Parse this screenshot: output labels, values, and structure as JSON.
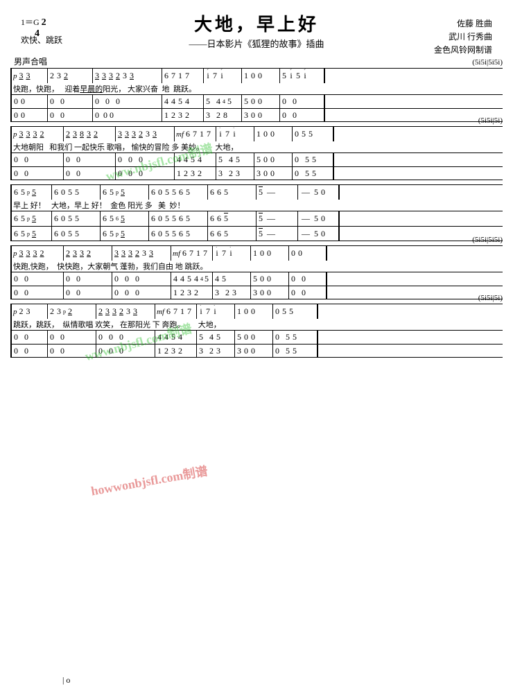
{
  "title": "大地，早上好",
  "subtitle": "——日本影片《狐狸的故事》插曲",
  "composer": {
    "line1": "佐藤 胜曲",
    "line2": "武川 行秀曲",
    "line3": "金色风铃网制谱"
  },
  "meta": {
    "key": "1＝G",
    "time": "2/4",
    "tempo": "欢快、跳跃"
  },
  "voice_label": "男声合唱",
  "watermark1": "www.nbjsfl.com制谱",
  "watermark2": "www.nbjsfl.com制谱",
  "hint1": "(5i5i|5i5i)",
  "hint2": "(5i5i|5i)",
  "hint3": "(5i5i|5i5i)",
  "hint4": "(5i5i|5i)",
  "systems": [
    {
      "id": "sys1",
      "hint": "(5i5i|5i5i)",
      "rows": [
        {
          "type": "notation",
          "dynamic": "p",
          "content": "3  3 | 2 3  2 | 3 3 3 2  3  3 | 6 7 1 7 | i  7 i | 1 0 0 | 5 i 5 i"
        },
        {
          "type": "lyrics",
          "content": "快跑，快跑，    迎着早晨的阳光，  大家兴奋  地  跳跃。"
        },
        {
          "type": "notation",
          "content": "0  0 | 0  0 | 0  0  0  | 0  0 | 4 4 5 4 5 | 4 4 5 5 | 0 0 | 0  0"
        },
        {
          "type": "notation",
          "content": "0  0 | 0  0 | 0  0  0  | 0  0 | 1 2 3 2 | 3  2 8 | 3 0 0 | 0  0"
        }
      ]
    }
  ]
}
